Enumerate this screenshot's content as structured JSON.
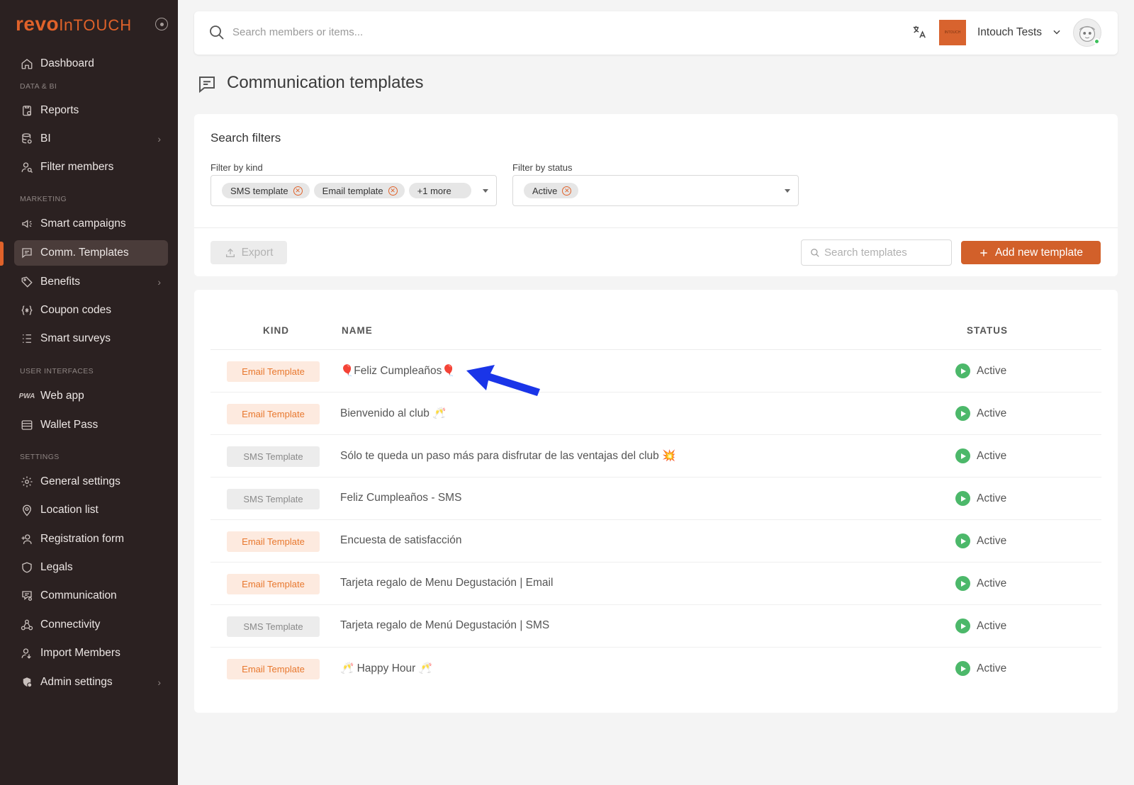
{
  "sidebar": {
    "logo": {
      "revo": "revo",
      "in": "In",
      "touch": "TOUCH"
    },
    "items": [
      {
        "label": "Dashboard",
        "icon": "home-icon"
      },
      {
        "label": "Reports",
        "icon": "clipboard-icon"
      },
      {
        "label": "BI",
        "icon": "database-search-icon"
      },
      {
        "label": "Filter members",
        "icon": "user-search-icon"
      },
      {
        "label": "Smart campaigns",
        "icon": "megaphone-icon"
      },
      {
        "label": "Comm. Templates",
        "icon": "message-icon"
      },
      {
        "label": "Benefits",
        "icon": "tag-icon"
      },
      {
        "label": "Coupon codes",
        "icon": "braces-asterisk-icon"
      },
      {
        "label": "Smart surveys",
        "icon": "list-icon"
      },
      {
        "label": "Web app",
        "icon": "pwa-icon"
      },
      {
        "label": "Wallet Pass",
        "icon": "wallet-icon"
      },
      {
        "label": "General settings",
        "icon": "gear-icon"
      },
      {
        "label": "Location list",
        "icon": "map-pin-icon"
      },
      {
        "label": "Registration form",
        "icon": "user-plus-icon"
      },
      {
        "label": "Legals",
        "icon": "shield-icon"
      },
      {
        "label": "Communication",
        "icon": "message-settings-icon"
      },
      {
        "label": "Connectivity",
        "icon": "webhook-icon"
      },
      {
        "label": "Import Members",
        "icon": "user-import-icon"
      },
      {
        "label": "Admin settings",
        "icon": "admin-icon"
      }
    ],
    "sections": {
      "data_bi": "DATA & BI",
      "marketing": "MARKETING",
      "user_interfaces": "USER INTERFACES",
      "settings": "SETTINGS"
    }
  },
  "topbar": {
    "search_placeholder": "Search members or items...",
    "brand_box_text": "INTOUCH",
    "account_name": "Intouch Tests"
  },
  "page": {
    "title": "Communication templates"
  },
  "filters": {
    "heading": "Search filters",
    "kind_label": "Filter by kind",
    "kind_chips": [
      "SMS template",
      "Email template"
    ],
    "kind_more": "+1 more",
    "status_label": "Filter by status",
    "status_chips": [
      "Active"
    ],
    "export_label": "Export",
    "search_placeholder": "Search templates",
    "add_label": "Add new template"
  },
  "table": {
    "headers": {
      "kind": "KIND",
      "name": "NAME",
      "status": "STATUS"
    },
    "rows": [
      {
        "kind": "Email Template",
        "kind_type": "email",
        "name": "🎈Feliz Cumpleaños🎈",
        "status": "Active"
      },
      {
        "kind": "Email Template",
        "kind_type": "email",
        "name": "Bienvenido al club 🥂",
        "status": "Active"
      },
      {
        "kind": "SMS Template",
        "kind_type": "sms",
        "name": "Sólo te queda un paso más para disfrutar de las ventajas del club 💥",
        "status": "Active"
      },
      {
        "kind": "SMS Template",
        "kind_type": "sms",
        "name": "Feliz Cumpleaños - SMS",
        "status": "Active"
      },
      {
        "kind": "Email Template",
        "kind_type": "email",
        "name": "Encuesta de satisfacción",
        "status": "Active"
      },
      {
        "kind": "Email Template",
        "kind_type": "email",
        "name": "Tarjeta regalo de Menu Degustación | Email",
        "status": "Active"
      },
      {
        "kind": "SMS Template",
        "kind_type": "sms",
        "name": "Tarjeta regalo de Menú Degustación | SMS",
        "status": "Active"
      },
      {
        "kind": "Email Template",
        "kind_type": "email",
        "name": "🥂 Happy Hour 🥂",
        "status": "Active"
      }
    ]
  },
  "colors": {
    "accent": "#e0622a",
    "sidebar_bg": "#2b2121",
    "status_green": "#4cb86a",
    "arrow_blue": "#1a35e8"
  }
}
